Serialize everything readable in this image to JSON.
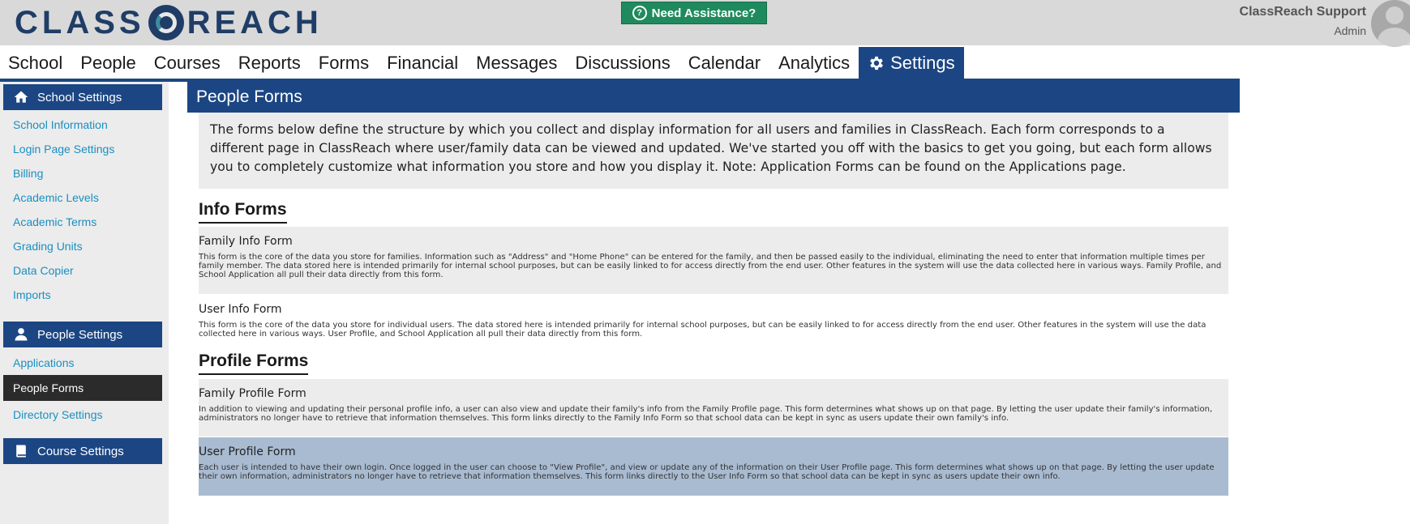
{
  "header": {
    "logo_text_left": "CLASS",
    "logo_text_right": "REACH",
    "assist_label": "Need Assistance?",
    "user_name": "ClassReach Support",
    "user_role": "Admin"
  },
  "nav": {
    "items": [
      {
        "label": "School"
      },
      {
        "label": "People"
      },
      {
        "label": "Courses"
      },
      {
        "label": "Reports"
      },
      {
        "label": "Forms"
      },
      {
        "label": "Financial"
      },
      {
        "label": "Messages"
      },
      {
        "label": "Discussions"
      },
      {
        "label": "Calendar"
      },
      {
        "label": "Analytics"
      },
      {
        "label": "Settings",
        "active": true,
        "icon": "gear-icon"
      }
    ]
  },
  "sidebar": {
    "school_settings": {
      "title": "School Settings",
      "icon": "home-icon",
      "items": [
        "School Information",
        "Login Page Settings",
        "Billing",
        "Academic Levels",
        "Academic Terms",
        "Grading Units",
        "Data Copier",
        "Imports"
      ]
    },
    "people_settings": {
      "title": "People Settings",
      "icon": "person-icon",
      "items": [
        "Applications",
        "People Forms",
        "Directory Settings"
      ],
      "active_item": "People Forms"
    },
    "course_settings": {
      "title": "Course Settings",
      "icon": "book-icon"
    }
  },
  "main": {
    "page_title": "People Forms",
    "intro": "The forms below define the structure by which you collect and display information for all users and families in ClassReach. Each form corresponds to a different page in ClassReach where user/family data can be viewed and updated. We've started you off with the basics to get you going, but each form allows you to completely customize what information you store and how you display it. Note: Application Forms can be found on the Applications page.",
    "info_forms_title": "Info Forms",
    "info_forms": [
      {
        "name": "Family Info Form",
        "description": "This form is the core of the data you store for families. Information such as \"Address\" and \"Home Phone\" can be entered for the family, and then be passed easily to the individual, eliminating the need to enter that information multiple times per family member. The data stored here is intended primarily for internal school purposes, but can be easily linked to for access directly from the end user. Other features in the system will use the data collected here in various ways. Family Profile, and School Application all pull their data directly from this form."
      },
      {
        "name": "User Info Form",
        "description": "This form is the core of the data you store for individual users. The data stored here is intended primarily for internal school purposes, but can be easily linked to for access directly from the end user. Other features in the system will use the data collected here in various ways. User Profile, and School Application all pull their data directly from this form."
      }
    ],
    "profile_forms_title": "Profile Forms",
    "profile_forms": [
      {
        "name": "Family Profile Form",
        "description": "In addition to viewing and updating their personal profile info, a user can also view and update their family's info from the Family Profile page. This form determines what shows up on that page. By letting the user update their family's information, administrators no longer have to retrieve that information themselves. This form links directly to the Family Info Form so that school data can be kept in sync as users update their own family's info."
      },
      {
        "name": "User Profile Form",
        "description": "Each user is intended to have their own login. Once logged in the user can choose to \"View Profile\", and view or update any of the information on their User Profile page. This form determines what shows up on that page. By letting the user update their own information, administrators no longer have to retrieve that information themselves. This form links directly to the User Info Form so that school data can be kept in sync as users update their own info."
      }
    ]
  },
  "colors": {
    "brand_navy": "#1c4683",
    "assist_green": "#1f8a5e",
    "link_blue": "#1a8fc1",
    "selected_row": "#a9bbd1",
    "panel_grey": "#ececec"
  }
}
